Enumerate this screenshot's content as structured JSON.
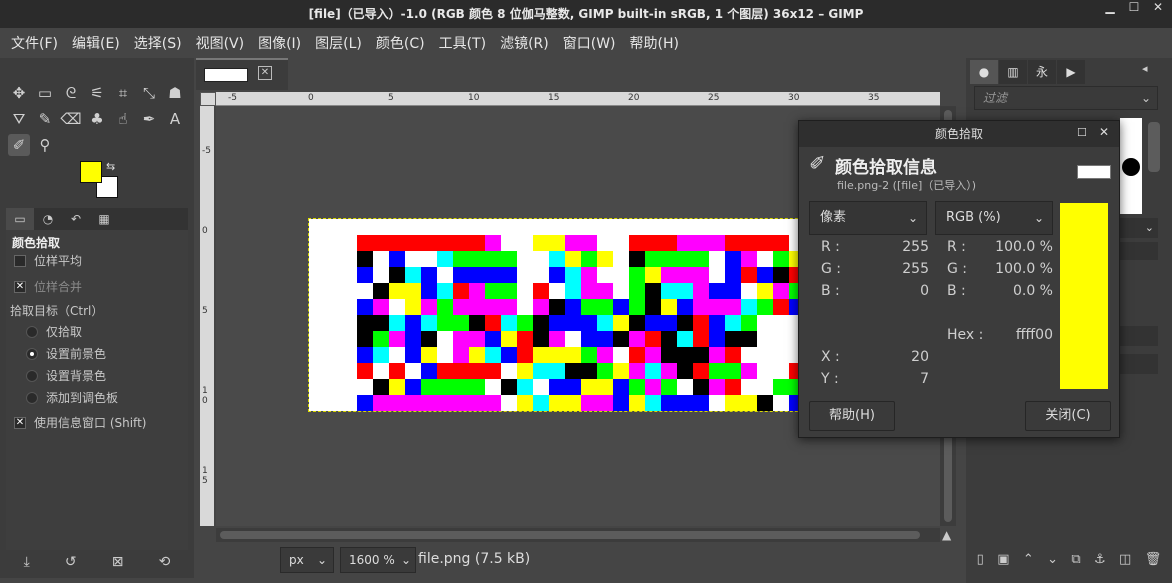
{
  "window": {
    "title": "[file]（已导入）-1.0 (RGB 颜色 8 位伽马整数, GIMP built-in sRGB, 1 个图层) 36x12 – GIMP",
    "min": "▁",
    "max": "☐",
    "close": "✕"
  },
  "menu": [
    "文件(F)",
    "编辑(E)",
    "选择(S)",
    "视图(V)",
    "图像(I)",
    "图层(L)",
    "颜色(C)",
    "工具(T)",
    "滤镜(R)",
    "窗口(W)",
    "帮助(H)"
  ],
  "tool_options": {
    "title": "颜色拾取",
    "sample_average": "位样平均",
    "sample_merged": "位样合并",
    "target_label": "拾取目标（Ctrl）",
    "pick_only": "仅拾取",
    "set_fg": "设置前景色",
    "set_bg": "设置背景色",
    "add_palette": "添加到调色板",
    "use_info": "使用信息窗口 (Shift)"
  },
  "colors": {
    "foreground": "#ffff00",
    "background": "#ffffff",
    "picked": "#ffff00"
  },
  "ruler": {
    "top": [
      "-5",
      "0",
      "5",
      "10",
      "15",
      "20",
      "25",
      "30",
      "35"
    ],
    "left": [
      "-5",
      "0",
      "5",
      "1\n0",
      "1\n5"
    ]
  },
  "status": {
    "unit": "px",
    "zoom": "1600 %",
    "file": "file.png (7.5 kB)"
  },
  "right_panel": {
    "filter_placeholder": "过滤"
  },
  "dialog": {
    "title": "颜色拾取",
    "heading": "颜色拾取信息",
    "subtitle": "file.png-2 ([file]（已导入）)",
    "left_mode": "像素",
    "right_mode": "RGB (%)",
    "pixel": {
      "R": "255",
      "G": "255",
      "B": "0",
      "X": "20",
      "Y": "7"
    },
    "pct": {
      "R": "100.0 %",
      "G": "100.0 %",
      "B": "0.0 %",
      "Hex": "ffff00"
    },
    "labels": {
      "R": "R :",
      "G": "G :",
      "B": "B :",
      "X": "X :",
      "Y": "Y :",
      "Hex": "Hex :"
    },
    "help": "帮助(H)",
    "close": "关闭(C)"
  },
  "image_pixels": [
    "...RRRRRRRRM..YYMM..RRRMMMRRRR..MMMMC.",
    "...K.BW.CGGGG..CYGY.KGGGG.BMWGY.GGGGG.",
    "...B.KCB.BBBB..BCMWWGYMMMWBRBKRBBBBBK",
    "...WKYYBCRMGG.RWCMMWGKCCMBBWYMGBCRRR.",
    "...BMWYMGMMMMWMKBGGBGKYBMMMCGRBKMYBM.",
    "...KKCBCGGKRCGKBBBCYKBBKRBCG.........",
    "...KGMBKWMMBYRKMWBBKMRKCRBKK.........",
    "...BCWBYWMYCBRYYYGMWRMKKKMRW.........",
    "...RWRWBRRRRWYCCKKGYMCMKRGGMW.RRRRRR.",
    "...WKYBGGGGWKCWBBYYBGMGWKMRW.GGGGGG..",
    "...BMMMMMMMM.YCYYMMBYCBBBWYYK.BBBBBB."
  ]
}
